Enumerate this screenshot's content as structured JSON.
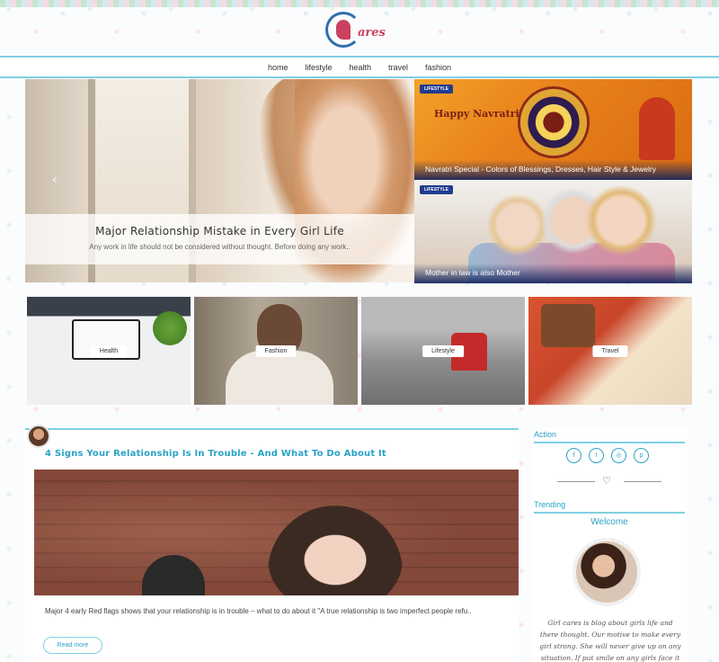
{
  "site": {
    "logo_text": "ares"
  },
  "nav": [
    "home",
    "lifestyle",
    "health",
    "travel",
    "fashion"
  ],
  "hero": {
    "title": "Major Relationship Mistake in Every Girl Life",
    "excerpt": "Any work in life should not be considered without thought. Before doing any work..",
    "prev_icon": "‹"
  },
  "side_cards": [
    {
      "tag": "LIFESTYLE",
      "image_text": "Happy Navratri",
      "title": "Navratri Special - Colors of Blessings, Dresses, Hair Style & Jewelry"
    },
    {
      "tag": "LIFESTYLE",
      "title": "Mother in law is also Mother"
    }
  ],
  "categories": [
    "Health",
    "Fashion",
    "Lifestyle",
    "Travel"
  ],
  "post": {
    "title": "4 Signs Your Relationship Is In Trouble - And What To Do About It",
    "excerpt": "Major 4 early Red flags shows that your relationship is in trouble – what to do about it \"A true relationship is two imperfect people refu..",
    "read_more": "Read more"
  },
  "sidebar": {
    "action_heading": "Action",
    "social": [
      {
        "icon": "facebook-icon",
        "glyph": "f"
      },
      {
        "icon": "twitter-icon",
        "glyph": "t"
      },
      {
        "icon": "instagram-icon",
        "glyph": "◎"
      },
      {
        "icon": "pinterest-icon",
        "glyph": "p"
      }
    ],
    "trending_heading": "Trending",
    "welcome_heading": "Welcome",
    "about": "Girl cares is blog about girls life and there thought. Our motive to make every girl strong. She will never give up on any situation. If put smile on any girls face it will be achievement for"
  },
  "colors": {
    "accent": "#2aa3c6",
    "rule": "#7fd0e0",
    "tag_bg": "#1f3b8f",
    "logo": "#c9415e"
  }
}
